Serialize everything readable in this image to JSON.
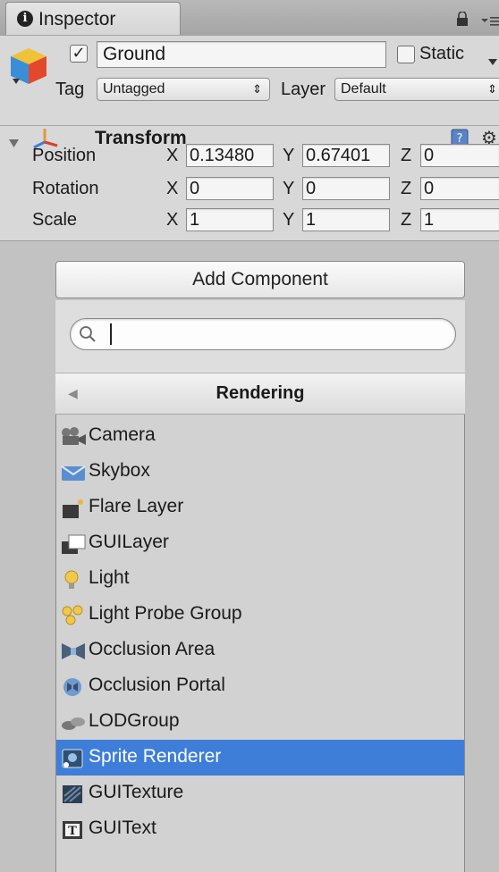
{
  "tab": {
    "title": "Inspector"
  },
  "object": {
    "name": "Ground",
    "active": true,
    "static_label": "Static",
    "static_checked": false
  },
  "tag": {
    "label": "Tag",
    "value": "Untagged"
  },
  "layer": {
    "label": "Layer",
    "value": "Default"
  },
  "transform": {
    "title": "Transform",
    "rows": [
      {
        "label": "Position",
        "x": "0.13480",
        "y": "0.67401",
        "z": "0"
      },
      {
        "label": "Rotation",
        "x": "0",
        "y": "0",
        "z": "0"
      },
      {
        "label": "Scale",
        "x": "1",
        "y": "1",
        "z": "1"
      }
    ],
    "axes": {
      "x": "X",
      "y": "Y",
      "z": "Z"
    }
  },
  "add_component": {
    "button_label": "Add Component",
    "search_value": "",
    "category": "Rendering",
    "items": [
      {
        "label": "Camera",
        "icon": "camera-icon"
      },
      {
        "label": "Skybox",
        "icon": "skybox-icon"
      },
      {
        "label": "Flare Layer",
        "icon": "flare-layer-icon"
      },
      {
        "label": "GUILayer",
        "icon": "gui-layer-icon"
      },
      {
        "label": "Light",
        "icon": "light-bulb-icon"
      },
      {
        "label": "Light Probe Group",
        "icon": "light-probe-group-icon"
      },
      {
        "label": "Occlusion Area",
        "icon": "occlusion-area-icon"
      },
      {
        "label": "Occlusion Portal",
        "icon": "occlusion-portal-icon"
      },
      {
        "label": "LODGroup",
        "icon": "lod-group-icon"
      },
      {
        "label": "Sprite Renderer",
        "icon": "sprite-renderer-icon",
        "selected": true
      },
      {
        "label": "GUITexture",
        "icon": "gui-texture-icon"
      },
      {
        "label": "GUIText",
        "icon": "gui-text-icon"
      }
    ]
  },
  "colors": {
    "selection": "#3e7ed8",
    "panel": "#c2c2c2"
  }
}
